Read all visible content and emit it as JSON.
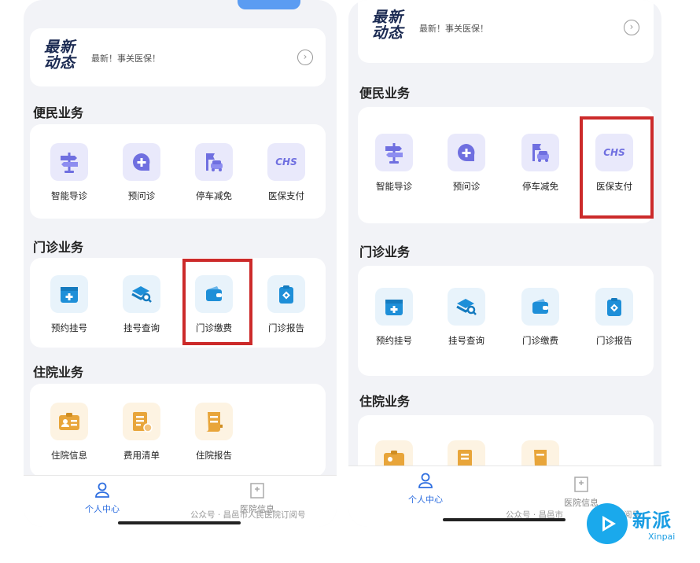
{
  "news": {
    "logo_line1": "最新",
    "logo_line2": "动态",
    "text": "最新！事关医保！",
    "arrow": "›"
  },
  "sections": {
    "convenience": "便民业务",
    "outpatient": "门诊业务",
    "inpatient": "住院业务"
  },
  "convenience_items": [
    {
      "label": "智能导诊",
      "icon": "signpost-icon"
    },
    {
      "label": "预问诊",
      "icon": "chat-plus-icon"
    },
    {
      "label": "停车减免",
      "icon": "parking-car-icon"
    },
    {
      "label": "医保支付",
      "icon": "chs-icon",
      "icon_text": "CHS"
    }
  ],
  "outpatient_items": [
    {
      "label": "预约挂号",
      "icon": "calendar-plus-icon"
    },
    {
      "label": "挂号查询",
      "icon": "layers-search-icon"
    },
    {
      "label": "门诊缴费",
      "icon": "wallet-icon"
    },
    {
      "label": "门诊报告",
      "icon": "clipboard-icon"
    }
  ],
  "inpatient_items": [
    {
      "label": "住院信息",
      "icon": "id-card-icon"
    },
    {
      "label": "费用清单",
      "icon": "receipt-list-icon"
    },
    {
      "label": "住院报告",
      "icon": "scroll-report-icon"
    }
  ],
  "tabbar": {
    "personal": "个人中心",
    "hospital_info": "医院信息"
  },
  "watermark_left": "公众号 · 昌邑市人民医院订阅号",
  "watermark_right": "公众号 · 昌邑市",
  "watermark_right_tail": "阅号",
  "branding": {
    "name": "新派",
    "name_en": "Xinpai"
  },
  "colors": {
    "highlight": "#cc2a2a",
    "active_tab": "#2f6fe0",
    "icon_blue": "#1e8fd8",
    "icon_purple": "#6f6fe0",
    "icon_orange": "#e8a53a"
  }
}
